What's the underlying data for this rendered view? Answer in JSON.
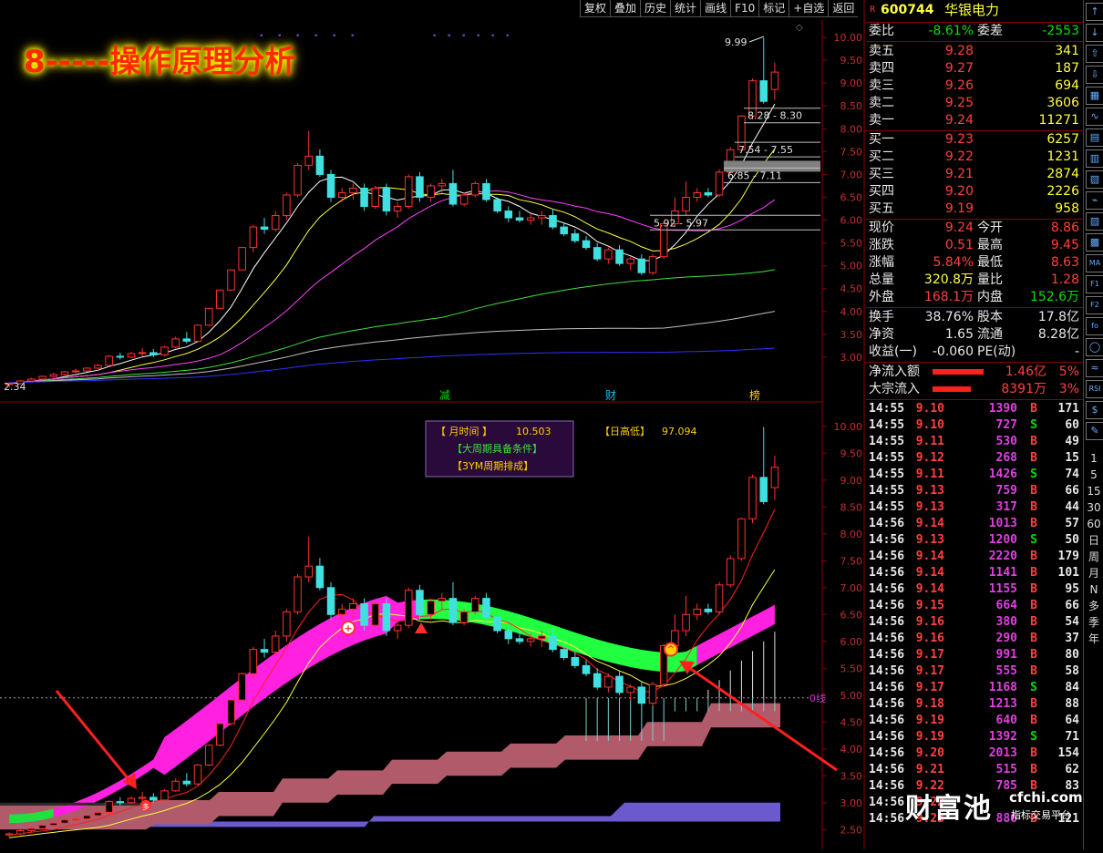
{
  "toolbar": [
    "复权",
    "叠加",
    "历史",
    "统计",
    "画线",
    "F10",
    "标记",
    "+自选",
    "返回"
  ],
  "title_banner": "8-----操作原理分析",
  "stock": {
    "marker": "R",
    "code": "600744",
    "name": "华银电力"
  },
  "weibi": {
    "label": "委比",
    "value": "-8.61%",
    "diff_label": "委差",
    "diff": "-2553"
  },
  "asks": [
    {
      "label": "卖五",
      "price": "9.28",
      "vol": "341"
    },
    {
      "label": "卖四",
      "price": "9.27",
      "vol": "187"
    },
    {
      "label": "卖三",
      "price": "9.26",
      "vol": "694"
    },
    {
      "label": "卖二",
      "price": "9.25",
      "vol": "3606"
    },
    {
      "label": "卖一",
      "price": "9.24",
      "vol": "11271"
    }
  ],
  "bids": [
    {
      "label": "买一",
      "price": "9.23",
      "vol": "6257"
    },
    {
      "label": "买二",
      "price": "9.22",
      "vol": "1231"
    },
    {
      "label": "买三",
      "price": "9.21",
      "vol": "2874"
    },
    {
      "label": "买四",
      "price": "9.20",
      "vol": "2226"
    },
    {
      "label": "买五",
      "price": "9.19",
      "vol": "958"
    }
  ],
  "stats": [
    {
      "l1": "现价",
      "v1": "9.24",
      "l2": "今开",
      "v2": "8.86"
    },
    {
      "l1": "涨跌",
      "v1": "0.51",
      "l2": "最高",
      "v2": "9.45"
    },
    {
      "l1": "涨幅",
      "v1": "5.84%",
      "l2": "最低",
      "v2": "8.63"
    },
    {
      "l1": "总量",
      "v1": "320.8万",
      "l2": "量比",
      "v2": "1.28"
    },
    {
      "l1": "外盘",
      "v1": "168.1万",
      "l2": "内盘",
      "v2": "152.6万"
    }
  ],
  "stats2": [
    {
      "l1": "换手",
      "v1": "38.76%",
      "l2": "股本",
      "v2": "17.8亿"
    },
    {
      "l1": "净资",
      "v1": "1.65",
      "l2": "流通",
      "v2": "8.28亿"
    },
    {
      "l1": "收益(一)",
      "v1": "-0.060",
      "l2": "PE(动)",
      "v2": "-"
    }
  ],
  "flows": [
    {
      "label": "净流入额",
      "value": "1.46亿",
      "pct": "5%"
    },
    {
      "label": "大宗流入",
      "value": "8391万",
      "pct": "3%"
    }
  ],
  "ticks": [
    {
      "t": "14:55",
      "p": "9.10",
      "v": "1390",
      "d": "B",
      "n": "171"
    },
    {
      "t": "14:55",
      "p": "9.10",
      "v": "727",
      "d": "S",
      "n": "60"
    },
    {
      "t": "14:55",
      "p": "9.11",
      "v": "530",
      "d": "B",
      "n": "49"
    },
    {
      "t": "14:55",
      "p": "9.12",
      "v": "268",
      "d": "B",
      "n": "15"
    },
    {
      "t": "14:55",
      "p": "9.11",
      "v": "1426",
      "d": "S",
      "n": "74"
    },
    {
      "t": "14:55",
      "p": "9.13",
      "v": "759",
      "d": "B",
      "n": "66"
    },
    {
      "t": "14:55",
      "p": "9.13",
      "v": "317",
      "d": "B",
      "n": "44"
    },
    {
      "t": "14:56",
      "p": "9.14",
      "v": "1013",
      "d": "B",
      "n": "57"
    },
    {
      "t": "14:56",
      "p": "9.13",
      "v": "1200",
      "d": "S",
      "n": "50"
    },
    {
      "t": "14:56",
      "p": "9.14",
      "v": "2220",
      "d": "B",
      "n": "179"
    },
    {
      "t": "14:56",
      "p": "9.14",
      "v": "1141",
      "d": "B",
      "n": "101"
    },
    {
      "t": "14:56",
      "p": "9.14",
      "v": "1155",
      "d": "B",
      "n": "95"
    },
    {
      "t": "14:56",
      "p": "9.15",
      "v": "664",
      "d": "B",
      "n": "66"
    },
    {
      "t": "14:56",
      "p": "9.16",
      "v": "380",
      "d": "B",
      "n": "54"
    },
    {
      "t": "14:56",
      "p": "9.16",
      "v": "290",
      "d": "B",
      "n": "37"
    },
    {
      "t": "14:56",
      "p": "9.17",
      "v": "991",
      "d": "B",
      "n": "80"
    },
    {
      "t": "14:56",
      "p": "9.17",
      "v": "555",
      "d": "B",
      "n": "58"
    },
    {
      "t": "14:56",
      "p": "9.17",
      "v": "1168",
      "d": "S",
      "n": "84"
    },
    {
      "t": "14:56",
      "p": "9.18",
      "v": "1213",
      "d": "B",
      "n": "88"
    },
    {
      "t": "14:56",
      "p": "9.19",
      "v": "640",
      "d": "B",
      "n": "64"
    },
    {
      "t": "14:56",
      "p": "9.19",
      "v": "1392",
      "d": "S",
      "n": "71"
    },
    {
      "t": "14:56",
      "p": "9.20",
      "v": "2013",
      "d": "B",
      "n": "154"
    },
    {
      "t": "14:56",
      "p": "9.21",
      "v": "515",
      "d": "B",
      "n": "62"
    },
    {
      "t": "14:56",
      "p": "9.22",
      "v": "785",
      "d": "B",
      "n": "83"
    },
    {
      "t": "14:56",
      "p": "9.22",
      "v": "",
      "d": "",
      "n": ""
    },
    {
      "t": "14:56",
      "p": "9.23",
      "v": "886",
      "d": "B",
      "n": "121"
    }
  ],
  "sidebar_tools": [
    "↑",
    "↓",
    "⇧",
    "⇩",
    "▦",
    "∿",
    "▤",
    "▥",
    "▧",
    "⌁",
    "▨",
    "▩",
    "MA",
    "F1",
    "F2",
    "fo",
    "◯",
    "≈",
    "RSI",
    "$",
    "✎"
  ],
  "periods": [
    "1",
    "5",
    "15",
    "30",
    "60",
    "日",
    "周",
    "月",
    "N",
    "多",
    "季",
    "年"
  ],
  "upper_chart": {
    "yticks": [
      "10.00",
      "9.50",
      "9.00",
      "8.50",
      "8.00",
      "7.50",
      "7.00",
      "6.50",
      "6.00",
      "5.50",
      "5.00",
      "4.50",
      "4.00",
      "3.50",
      "3.00"
    ],
    "price_range": [
      2.3,
      10.2
    ],
    "low_label": "2.34",
    "high_label": "9.99",
    "boxes": [
      "8.28 - 8.30",
      "7.54 - 7.55",
      "6.85 - 7.11",
      "5.92 - 5.97"
    ],
    "markers": [
      {
        "label": "减",
        "color": "#00e000"
      },
      {
        "label": "财",
        "color": "#00c0ff"
      },
      {
        "label": "榜",
        "color": "#ffd000"
      }
    ]
  },
  "lower_chart": {
    "yticks": [
      "10.00",
      "9.50",
      "9.00",
      "8.50",
      "8.00",
      "7.50",
      "7.00",
      "6.50",
      "6.00",
      "5.50",
      "5.00",
      "4.50",
      "4.00",
      "3.50",
      "3.00",
      "2.50"
    ],
    "price_range": [
      2.3,
      10.2
    ],
    "info_box": {
      "line1_label": "【 月时间 】",
      "line1_value": "10.503",
      "line2": "【大周期具备条件】",
      "line3": "【3YM周期排成】"
    },
    "high_box": {
      "label": "【日高低】",
      "value": "97.094"
    },
    "zero_label": "0线"
  },
  "watermark": {
    "main": "财富池",
    "site": "cfchi.com",
    "sub": "指标交易平台"
  },
  "chart_data": {
    "type": "candlestick",
    "series": [
      {
        "name": "daily",
        "ohlc": [
          [
            2.4,
            2.45,
            2.34,
            2.42
          ],
          [
            2.42,
            2.5,
            2.4,
            2.48
          ],
          [
            2.48,
            2.55,
            2.45,
            2.52
          ],
          [
            2.52,
            2.6,
            2.5,
            2.58
          ],
          [
            2.58,
            2.66,
            2.55,
            2.62
          ],
          [
            2.62,
            2.7,
            2.6,
            2.68
          ],
          [
            2.68,
            2.75,
            2.65,
            2.7
          ],
          [
            2.7,
            2.78,
            2.68,
            2.76
          ],
          [
            2.76,
            2.85,
            2.74,
            2.82
          ],
          [
            2.82,
            3.05,
            2.8,
            3.02
          ],
          [
            3.02,
            3.1,
            2.95,
            3.0
          ],
          [
            3.0,
            3.12,
            2.98,
            3.08
          ],
          [
            3.08,
            3.2,
            3.02,
            3.1
          ],
          [
            3.1,
            3.18,
            3.0,
            3.05
          ],
          [
            3.05,
            3.25,
            3.02,
            3.22
          ],
          [
            3.22,
            3.45,
            3.2,
            3.4
          ],
          [
            3.4,
            3.55,
            3.3,
            3.35
          ],
          [
            3.35,
            3.72,
            3.32,
            3.7
          ],
          [
            3.7,
            4.08,
            3.68,
            4.07
          ],
          [
            4.07,
            4.48,
            4.05,
            4.47
          ],
          [
            4.47,
            4.92,
            4.45,
            4.91
          ],
          [
            4.91,
            5.42,
            4.9,
            5.4
          ],
          [
            5.4,
            5.9,
            5.3,
            5.85
          ],
          [
            5.85,
            6.05,
            5.7,
            5.8
          ],
          [
            5.8,
            6.2,
            5.75,
            6.1
          ],
          [
            6.1,
            6.6,
            6.0,
            6.55
          ],
          [
            6.55,
            7.25,
            6.5,
            7.2
          ],
          [
            7.2,
            7.95,
            7.1,
            7.4
          ],
          [
            7.4,
            7.55,
            6.95,
            7.0
          ],
          [
            7.0,
            7.1,
            6.4,
            6.5
          ],
          [
            6.5,
            6.7,
            6.4,
            6.6
          ],
          [
            6.6,
            6.8,
            6.45,
            6.7
          ],
          [
            6.7,
            6.8,
            6.2,
            6.3
          ],
          [
            6.3,
            6.75,
            6.25,
            6.7
          ],
          [
            6.7,
            6.8,
            6.1,
            6.2
          ],
          [
            6.2,
            6.4,
            6.05,
            6.3
          ],
          [
            6.3,
            7.0,
            6.25,
            6.95
          ],
          [
            6.95,
            7.05,
            6.4,
            6.5
          ],
          [
            6.5,
            6.8,
            6.4,
            6.75
          ],
          [
            6.75,
            6.9,
            6.6,
            6.8
          ],
          [
            6.8,
            7.1,
            6.3,
            6.35
          ],
          [
            6.35,
            6.6,
            6.3,
            6.55
          ],
          [
            6.55,
            6.85,
            6.5,
            6.8
          ],
          [
            6.8,
            6.9,
            6.4,
            6.45
          ],
          [
            6.45,
            6.5,
            6.15,
            6.2
          ],
          [
            6.2,
            6.3,
            5.95,
            6.05
          ],
          [
            6.05,
            6.2,
            5.95,
            6.0
          ],
          [
            6.0,
            6.15,
            5.9,
            6.05
          ],
          [
            6.05,
            6.2,
            5.9,
            6.1
          ],
          [
            6.1,
            6.25,
            5.8,
            5.85
          ],
          [
            5.85,
            5.95,
            5.65,
            5.7
          ],
          [
            5.7,
            5.8,
            5.5,
            5.55
          ],
          [
            5.55,
            5.65,
            5.35,
            5.4
          ],
          [
            5.4,
            5.5,
            5.1,
            5.15
          ],
          [
            5.15,
            5.4,
            5.05,
            5.35
          ],
          [
            5.35,
            5.45,
            5.0,
            5.05
          ],
          [
            5.05,
            5.2,
            4.9,
            5.15
          ],
          [
            5.15,
            5.25,
            4.8,
            4.85
          ],
          [
            4.85,
            5.25,
            4.8,
            5.2
          ],
          [
            5.2,
            5.95,
            5.15,
            5.92
          ],
          [
            5.92,
            6.5,
            5.85,
            6.2
          ],
          [
            6.2,
            6.85,
            6.1,
            6.5
          ],
          [
            6.5,
            6.7,
            6.4,
            6.6
          ],
          [
            6.6,
            6.7,
            6.5,
            6.55
          ],
          [
            6.55,
            7.11,
            6.5,
            7.05
          ],
          [
            7.05,
            7.6,
            7.0,
            7.54
          ],
          [
            7.54,
            8.3,
            7.5,
            8.28
          ],
          [
            8.28,
            9.1,
            8.2,
            9.05
          ],
          [
            9.05,
            9.99,
            8.55,
            8.6
          ],
          [
            8.86,
            9.45,
            8.63,
            9.24
          ]
        ]
      }
    ],
    "moving_averages": [
      "MA5",
      "MA10",
      "MA20",
      "MA60",
      "MA120",
      "MA250"
    ]
  }
}
